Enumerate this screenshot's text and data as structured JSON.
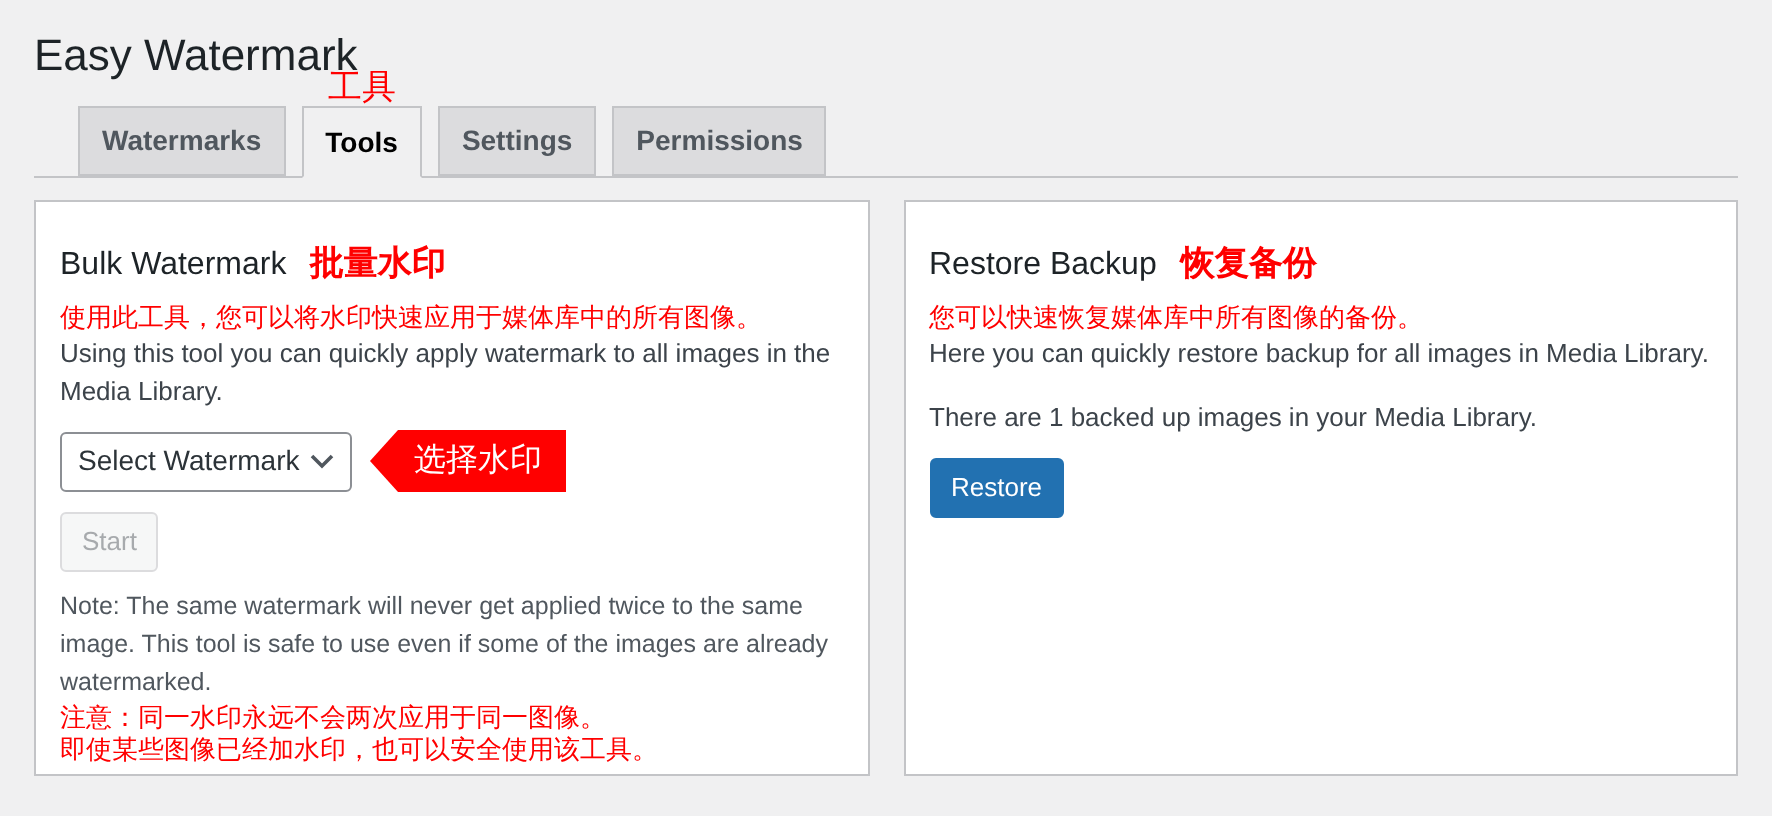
{
  "page_title": "Easy Watermark",
  "tabs": [
    {
      "label": "Watermarks",
      "selected": false
    },
    {
      "label": "Tools",
      "selected": true,
      "annotation": "工具"
    },
    {
      "label": "Settings",
      "selected": false
    },
    {
      "label": "Permissions",
      "selected": false
    }
  ],
  "bulk_panel": {
    "title": "Bulk Watermark",
    "title_annotation": "批量水印",
    "description_annotation": "使用此工具，您可以将水印快速应用于媒体库中的所有图像。",
    "description": "Using this tool you can quickly apply watermark to all images in the Media Library.",
    "select": {
      "value": "Select Watermark",
      "annotation": "选择水印"
    },
    "start_button": {
      "label": "Start",
      "disabled": true
    },
    "note": "Note: The same watermark will never get applied twice to the same image. This tool is safe to use even if some of the images are already watermarked.",
    "note_annotations": [
      "注意：同一水印永远不会两次应用于同一图像。",
      "即使某些图像已经加水印，也可以安全使用该工具。"
    ]
  },
  "restore_panel": {
    "title": "Restore Backup",
    "title_annotation": "恢复备份",
    "description_annotation": "您可以快速恢复媒体库中所有图像的备份。",
    "description": "Here you can quickly restore backup for all images in Media Library.",
    "status": "There are 1 backed up images in your Media Library.",
    "restore_button": {
      "label": "Restore",
      "disabled": false
    }
  }
}
